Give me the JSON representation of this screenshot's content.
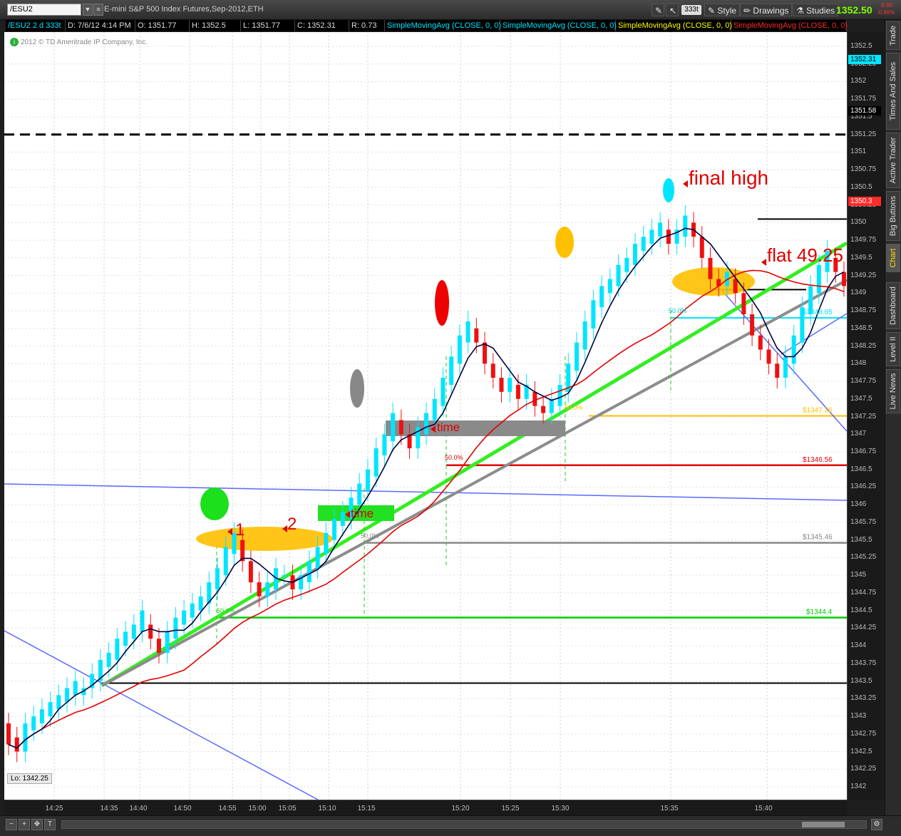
{
  "toolbar": {
    "symbol": "/ESU2",
    "title": "E-mini S&P 500 Index Futures,Sep-2012,ETH",
    "aggregation": "333t",
    "style_label": "Style",
    "drawings_label": "Drawings",
    "studies_label": "Studies",
    "last_price": "1352.50",
    "change_abs": "-9.00",
    "change_pct": "-0.66%"
  },
  "header": {
    "symbol_period": "/ESU2 2 d 333t",
    "date": "D: 7/6/12 4:14 PM",
    "open": "O: 1351.77",
    "high": "H: 1352.5",
    "low": "L: 1351.77",
    "close": "C: 1352.31",
    "range": "R: 0.73",
    "studies": [
      {
        "label": "SimpleMovingAvg (CLOSE, 0, 0)",
        "color": "#00e5ff"
      },
      {
        "label": "SimpleMovingAvg (CLOSE, 0, 0)",
        "color": "#00e5ff"
      },
      {
        "label": "SimpleMovingAvg (CLOSE, 0, 0)",
        "color": "#ffff00"
      },
      {
        "label": "SimpleMovingAvg (CLOSE, 0, 0)",
        "color": "#ff2a2a"
      }
    ]
  },
  "copyright": "2012 © TD Ameritrade IP Company, Inc.",
  "lo_label": "Lo: 1342.25",
  "price_axis": {
    "ticks": [
      "1352.5",
      "1352.25",
      "1352",
      "1351.75",
      "1351.5",
      "1351.25",
      "1351",
      "1350.75",
      "1350.5",
      "1350.25",
      "1350",
      "1349.75",
      "1349.5",
      "1349.25",
      "1349",
      "1348.75",
      "1348.5",
      "1348.25",
      "1348",
      "1347.75",
      "1347.5",
      "1347.25",
      "1347",
      "1346.75",
      "1346.5",
      "1346.25",
      "1346",
      "1345.75",
      "1345.5",
      "1345.25",
      "1345",
      "1344.75",
      "1344.5",
      "1344.25",
      "1344",
      "1343.75",
      "1343.5",
      "1343.25",
      "1343",
      "1342.75",
      "1342.5",
      "1342.25",
      "1342"
    ],
    "badges": [
      {
        "value": "1352.31",
        "price": 1352.31,
        "bg": "#00e5ff",
        "fg": "#000"
      },
      {
        "value": "1351.58",
        "price": 1351.58,
        "bg": "#000000",
        "fg": "#fff"
      },
      {
        "value": "1350.3",
        "price": 1350.3,
        "bg": "#ff2a2a",
        "fg": "#fff"
      }
    ]
  },
  "time_axis": [
    "14:25",
    "14:35",
    "14:40",
    "14:50",
    "14:55",
    "15:00",
    "15:05",
    "15:10",
    "15:15",
    "15:20",
    "15:25",
    "15:30",
    "15:35",
    "15:40"
  ],
  "annotations": {
    "final_high": "final high",
    "flat": "flat 49.25",
    "time1": "time",
    "time2": "time",
    "one": "1",
    "two": "2"
  },
  "levels": [
    {
      "label": "$1347.26",
      "price": 1347.26,
      "color": "#ffc000"
    },
    {
      "label": "$1346.56",
      "price": 1346.56,
      "color": "#e00000"
    },
    {
      "label": "$1345.46",
      "price": 1345.46,
      "color": "#888888"
    },
    {
      "label": "$1344.4",
      "price": 1344.4,
      "color": "#00cc00"
    },
    {
      "label": "$1348.65",
      "price": 1348.65,
      "color": "#00e5ff"
    }
  ],
  "fib_labels": [
    "50.0%",
    "50.0%",
    "50.0%",
    "50.0%",
    "50.0%"
  ],
  "side_tabs": [
    "Trade",
    "Times And Sales",
    "Active Trader",
    "Big Buttons",
    "Chart",
    "Dashboard",
    "Level II",
    "Live News"
  ],
  "chart_data": {
    "type": "candlestick",
    "symbol": "/ESU2",
    "interval": "333 ticks",
    "ylim": [
      1341.8,
      1352.7
    ],
    "lo": 1342.25,
    "series_names": [],
    "candles": [
      {
        "o": 1342.9,
        "c": 1342.6
      },
      {
        "o": 1342.7,
        "c": 1342.5
      },
      {
        "o": 1342.5,
        "c": 1342.9
      },
      {
        "o": 1342.8,
        "c": 1343.0
      },
      {
        "o": 1342.9,
        "c": 1343.1
      },
      {
        "o": 1343.0,
        "c": 1343.2
      },
      {
        "o": 1343.1,
        "c": 1343.3
      },
      {
        "o": 1343.2,
        "c": 1343.4
      },
      {
        "o": 1343.3,
        "c": 1343.5
      },
      {
        "o": 1343.3,
        "c": 1343.4
      },
      {
        "o": 1343.4,
        "c": 1343.6
      },
      {
        "o": 1343.5,
        "c": 1343.8
      },
      {
        "o": 1343.7,
        "c": 1343.9
      },
      {
        "o": 1343.8,
        "c": 1344.1
      },
      {
        "o": 1344.0,
        "c": 1344.2
      },
      {
        "o": 1344.1,
        "c": 1344.3
      },
      {
        "o": 1344.2,
        "c": 1344.5
      },
      {
        "o": 1344.3,
        "c": 1344.1
      },
      {
        "o": 1344.1,
        "c": 1343.9
      },
      {
        "o": 1343.9,
        "c": 1344.2
      },
      {
        "o": 1344.1,
        "c": 1344.4
      },
      {
        "o": 1344.3,
        "c": 1344.5
      },
      {
        "o": 1344.4,
        "c": 1344.6
      },
      {
        "o": 1344.5,
        "c": 1344.7
      },
      {
        "o": 1344.6,
        "c": 1344.9
      },
      {
        "o": 1344.8,
        "c": 1345.1
      },
      {
        "o": 1345.0,
        "c": 1345.4
      },
      {
        "o": 1345.3,
        "c": 1345.6
      },
      {
        "o": 1345.5,
        "c": 1345.2
      },
      {
        "o": 1345.2,
        "c": 1344.9
      },
      {
        "o": 1344.9,
        "c": 1344.7
      },
      {
        "o": 1344.7,
        "c": 1344.9
      },
      {
        "o": 1344.8,
        "c": 1345.1
      },
      {
        "o": 1345.0,
        "c": 1345.0
      },
      {
        "o": 1345.0,
        "c": 1344.8
      },
      {
        "o": 1344.8,
        "c": 1345.0
      },
      {
        "o": 1344.9,
        "c": 1345.2
      },
      {
        "o": 1345.1,
        "c": 1345.4
      },
      {
        "o": 1345.3,
        "c": 1345.6
      },
      {
        "o": 1345.5,
        "c": 1345.8
      },
      {
        "o": 1345.7,
        "c": 1345.9
      },
      {
        "o": 1345.8,
        "c": 1346.1
      },
      {
        "o": 1346.0,
        "c": 1346.3
      },
      {
        "o": 1346.2,
        "c": 1346.5
      },
      {
        "o": 1346.4,
        "c": 1346.8
      },
      {
        "o": 1346.7,
        "c": 1347.0
      },
      {
        "o": 1346.9,
        "c": 1347.3
      },
      {
        "o": 1347.2,
        "c": 1347.0
      },
      {
        "o": 1347.0,
        "c": 1346.8
      },
      {
        "o": 1346.8,
        "c": 1347.1
      },
      {
        "o": 1347.0,
        "c": 1347.3
      },
      {
        "o": 1347.2,
        "c": 1347.5
      },
      {
        "o": 1347.4,
        "c": 1347.8
      },
      {
        "o": 1347.7,
        "c": 1348.1
      },
      {
        "o": 1348.0,
        "c": 1348.4
      },
      {
        "o": 1348.3,
        "c": 1348.6
      },
      {
        "o": 1348.5,
        "c": 1348.3
      },
      {
        "o": 1348.3,
        "c": 1348.0
      },
      {
        "o": 1348.0,
        "c": 1347.8
      },
      {
        "o": 1347.8,
        "c": 1347.6
      },
      {
        "o": 1347.6,
        "c": 1347.8
      },
      {
        "o": 1347.7,
        "c": 1347.5
      },
      {
        "o": 1347.5,
        "c": 1347.7
      },
      {
        "o": 1347.6,
        "c": 1347.4
      },
      {
        "o": 1347.4,
        "c": 1347.3
      },
      {
        "o": 1347.3,
        "c": 1347.5
      },
      {
        "o": 1347.4,
        "c": 1347.7
      },
      {
        "o": 1347.6,
        "c": 1348.0
      },
      {
        "o": 1347.9,
        "c": 1348.3
      },
      {
        "o": 1348.2,
        "c": 1348.6
      },
      {
        "o": 1348.5,
        "c": 1348.9
      },
      {
        "o": 1348.8,
        "c": 1349.1
      },
      {
        "o": 1349.0,
        "c": 1349.2
      },
      {
        "o": 1349.1,
        "c": 1349.4
      },
      {
        "o": 1349.3,
        "c": 1349.5
      },
      {
        "o": 1349.4,
        "c": 1349.7
      },
      {
        "o": 1349.6,
        "c": 1349.8
      },
      {
        "o": 1349.7,
        "c": 1349.9
      },
      {
        "o": 1349.8,
        "c": 1350.0
      },
      {
        "o": 1349.9,
        "c": 1349.7
      },
      {
        "o": 1349.7,
        "c": 1349.9
      },
      {
        "o": 1349.8,
        "c": 1350.1
      },
      {
        "o": 1350.0,
        "c": 1349.8
      },
      {
        "o": 1349.8,
        "c": 1349.5
      },
      {
        "o": 1349.5,
        "c": 1349.2
      },
      {
        "o": 1349.2,
        "c": 1349.1
      },
      {
        "o": 1349.1,
        "c": 1349.3
      },
      {
        "o": 1349.2,
        "c": 1349.0
      },
      {
        "o": 1349.0,
        "c": 1348.7
      },
      {
        "o": 1348.7,
        "c": 1348.4
      },
      {
        "o": 1348.4,
        "c": 1348.2
      },
      {
        "o": 1348.2,
        "c": 1348.0
      },
      {
        "o": 1348.0,
        "c": 1347.8
      },
      {
        "o": 1347.8,
        "c": 1348.1
      },
      {
        "o": 1348.0,
        "c": 1348.4
      },
      {
        "o": 1348.3,
        "c": 1348.8
      },
      {
        "o": 1348.7,
        "c": 1349.1
      },
      {
        "o": 1349.0,
        "c": 1349.4
      },
      {
        "o": 1349.3,
        "c": 1349.6
      },
      {
        "o": 1349.5,
        "c": 1349.3
      },
      {
        "o": 1349.3,
        "c": 1349.1
      }
    ]
  }
}
